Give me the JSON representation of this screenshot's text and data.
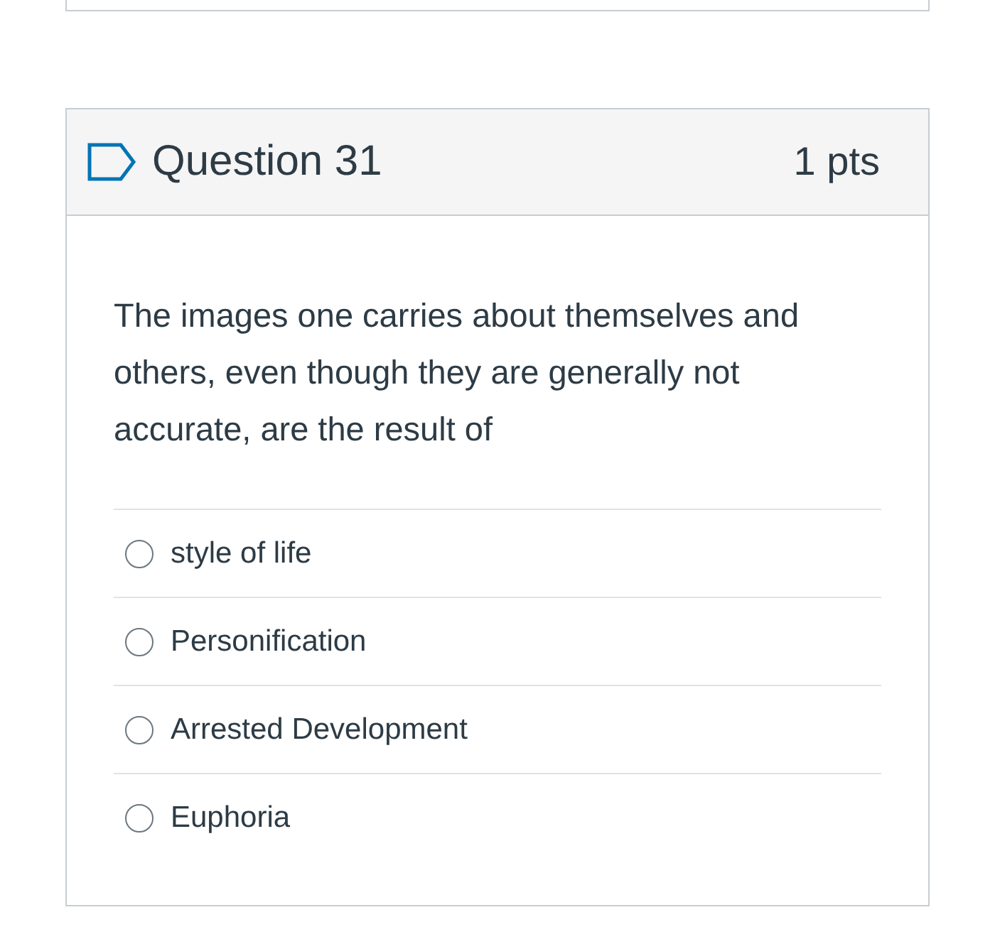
{
  "question": {
    "title": "Question 31",
    "points": "1 pts",
    "flagged": false,
    "text": "The images one carries about themselves and others, even though they are generally not accurate, are the result of",
    "answers": [
      {
        "label": "style of life",
        "selected": false
      },
      {
        "label": "Personification",
        "selected": false
      },
      {
        "label": "Arrested Development",
        "selected": false
      },
      {
        "label": "Euphoria",
        "selected": false
      }
    ]
  }
}
